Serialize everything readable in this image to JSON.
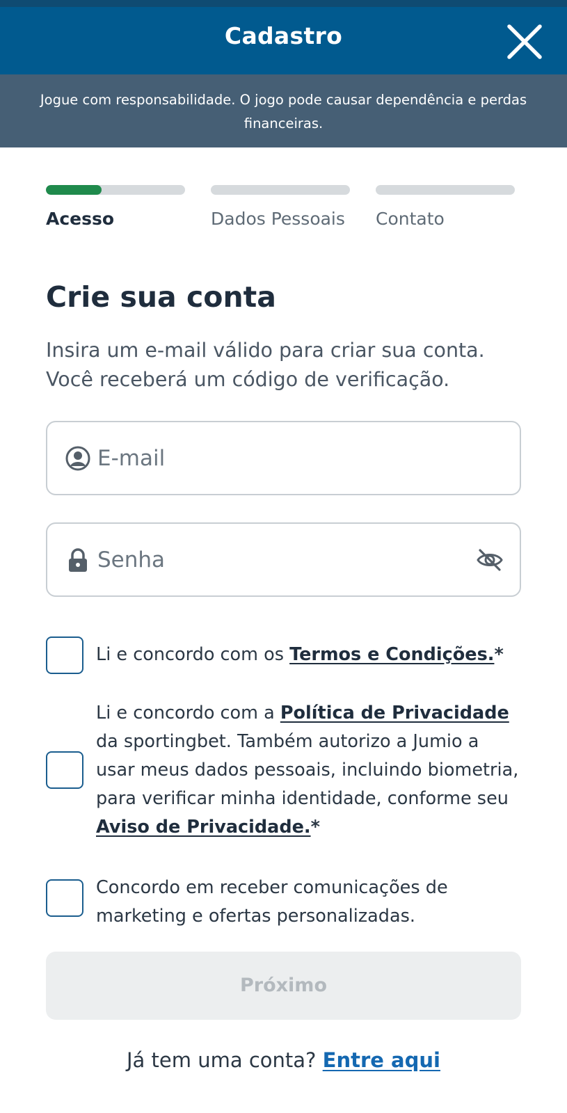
{
  "header": {
    "title": "Cadastro",
    "close_icon": "close-icon"
  },
  "banner": {
    "text": "Jogue com responsabilidade. O jogo pode causar dependência e perdas financeiras."
  },
  "steps": [
    {
      "label": "Acesso",
      "active": true,
      "progress": 0.4
    },
    {
      "label": "Dados Pessoais",
      "active": false,
      "progress": 0
    },
    {
      "label": "Contato",
      "active": false,
      "progress": 0
    }
  ],
  "form": {
    "heading": "Crie sua conta",
    "subtext": "Insira um e-mail válido para criar sua conta. Você receberá um código de verificação.",
    "email": {
      "placeholder": "E-mail",
      "value": "",
      "icon": "user-circle-icon"
    },
    "password": {
      "placeholder": "Senha",
      "value": "",
      "icon": "lock-icon",
      "toggle_icon": "eye-off-icon"
    }
  },
  "consents": {
    "terms": {
      "prefix": "Li e concordo com os ",
      "link": "Termos e Condições.",
      "suffix": "*",
      "checked": false
    },
    "privacy": {
      "prefix": "Li e concordo com a ",
      "link1": "Política de Privacidade ",
      "middle": "da sportingbet. Também autorizo a Jumio a usar meus dados pessoais, incluindo biometria, para verificar minha identidade, conforme seu ",
      "link2": "Aviso de Privacidade.",
      "suffix": "*",
      "checked": false
    },
    "marketing": {
      "text": "Concordo em receber comunicações de marketing e ofertas personalizadas.",
      "checked": false
    }
  },
  "next_button": {
    "label": "Próximo",
    "enabled": false
  },
  "login": {
    "prompt": "Já tem uma conta? ",
    "link": "Entre aqui"
  },
  "colors": {
    "header_bg": "#015a8f",
    "banner_bg": "#465f75",
    "progress_fill": "#1f8a4c",
    "link": "#1468b1",
    "checkbox_border": "#1a5d8e"
  }
}
